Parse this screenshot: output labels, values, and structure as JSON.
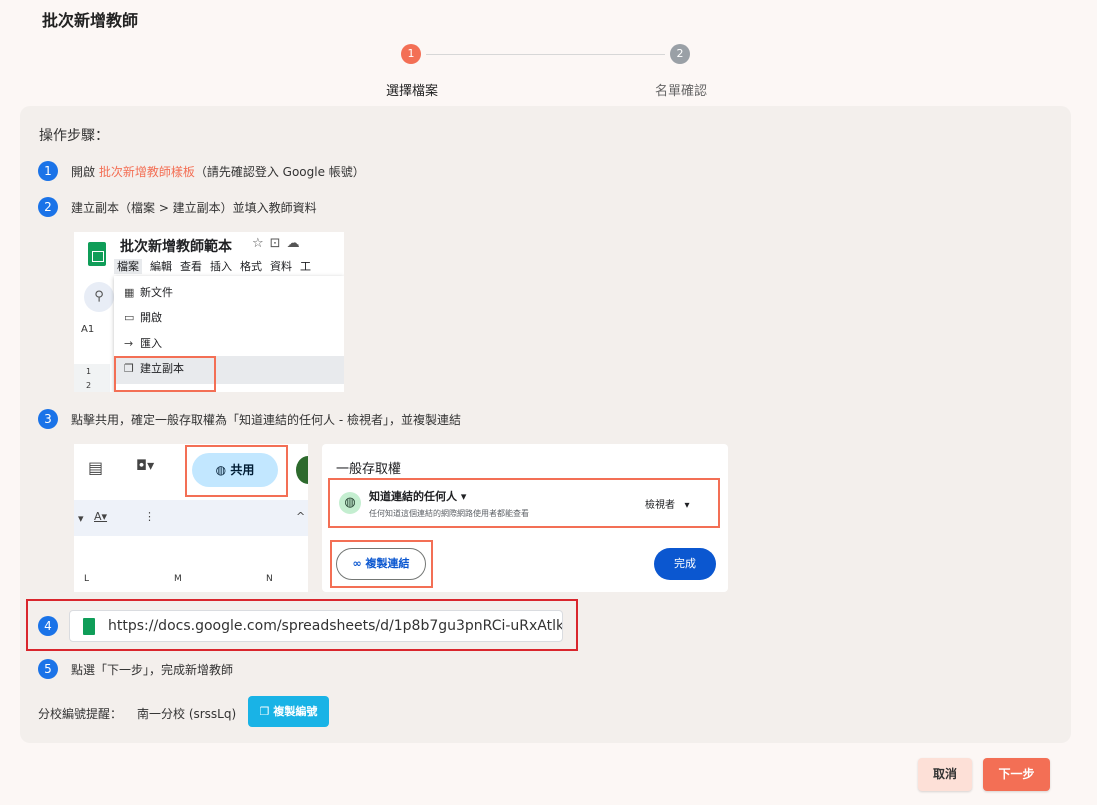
{
  "title": "批次新增教師",
  "stepper": {
    "steps": [
      {
        "number": "1",
        "label": "選擇檔案",
        "active": true
      },
      {
        "number": "2",
        "label": "名單確認",
        "active": false
      }
    ]
  },
  "instructions": {
    "heading": "操作步驟：",
    "step1": {
      "num": "1",
      "prefix": "開啟 ",
      "link": "批次新增教師樣板",
      "suffix": "（請先確認登入 Google 帳號）"
    },
    "step2": {
      "num": "2",
      "text": "建立副本（檔案 > 建立副本）並填入教師資料"
    },
    "step3": {
      "num": "3",
      "text": "點擊共用，確定一般存取權為「知道連結的任何人 - 檢視者」，並複製連結"
    },
    "step4": {
      "num": "4"
    },
    "step5": {
      "num": "5",
      "text": "點選「下一步」，完成新增教師"
    }
  },
  "screenshot1": {
    "doc_title": "批次新增教師範本",
    "menus": [
      "檔案",
      "編輯",
      "查看",
      "插入",
      "格式",
      "資料",
      "工"
    ],
    "cell_ref": "A1",
    "menu_items": [
      "新文件",
      "開啟",
      "匯入",
      "建立副本"
    ],
    "row_numbers": [
      "1",
      "2"
    ]
  },
  "screenshot2": {
    "share_label": "共用",
    "columns": [
      "L",
      "M",
      "N"
    ]
  },
  "screenshot3": {
    "general_access": "一般存取權",
    "who": "知道連結的任何人",
    "who_sub": "任何知道這個連結的網際網路使用者都能查看",
    "role": "檢視者",
    "copy_link": "複製連結",
    "done": "完成"
  },
  "url_field": {
    "value": "https://docs.google.com/spreadsheets/d/1p8b7gu3pnRCi-uRxAtlk..."
  },
  "campus": {
    "label": "分校編號提醒：",
    "value": "南一分校 (srssLq)",
    "copy_button": "複製編號"
  },
  "footer": {
    "cancel": "取消",
    "next": "下一步"
  },
  "colors": {
    "accent": "#f36f55",
    "step_badge": "#1a73e8",
    "highlight_red": "#d9262d",
    "copy_button": "#19b3e6"
  }
}
